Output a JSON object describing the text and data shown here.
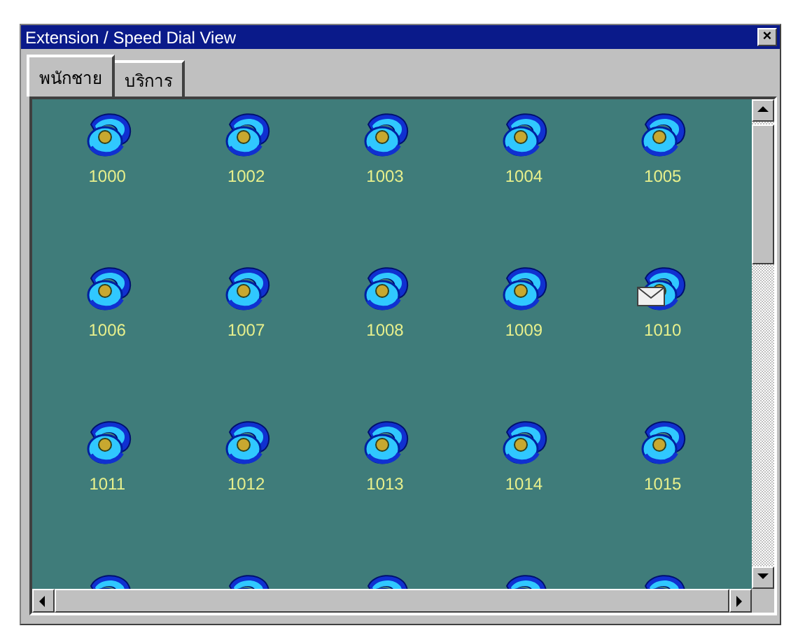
{
  "window": {
    "title": "Extension / Speed Dial View",
    "close": "×"
  },
  "tabs": [
    {
      "label": "พนักชาย",
      "selected": true
    },
    {
      "label": "บริการ",
      "selected": false
    }
  ],
  "extensions": [
    {
      "kind": "extension",
      "number": "1000",
      "message": false
    },
    {
      "kind": "extension",
      "number": "1002",
      "message": false
    },
    {
      "kind": "extension",
      "number": "1003",
      "message": false
    },
    {
      "kind": "extension",
      "number": "1004",
      "message": false
    },
    {
      "kind": "extension",
      "number": "1005",
      "message": false
    },
    {
      "kind": "extension",
      "number": "1006",
      "message": false
    },
    {
      "kind": "extension",
      "number": "1007",
      "message": false
    },
    {
      "kind": "extension",
      "number": "1008",
      "message": false
    },
    {
      "kind": "extension",
      "number": "1009",
      "message": false
    },
    {
      "kind": "extension",
      "number": "1010",
      "message": true
    },
    {
      "kind": "extension",
      "number": "1011",
      "message": false
    },
    {
      "kind": "extension",
      "number": "1012",
      "message": false
    },
    {
      "kind": "extension",
      "number": "1013",
      "message": false
    },
    {
      "kind": "extension",
      "number": "1014",
      "message": false
    },
    {
      "kind": "extension",
      "number": "1015",
      "message": false
    },
    {
      "kind": "partial"
    },
    {
      "kind": "partial"
    },
    {
      "kind": "partial"
    },
    {
      "kind": "partial"
    },
    {
      "kind": "partial"
    }
  ]
}
